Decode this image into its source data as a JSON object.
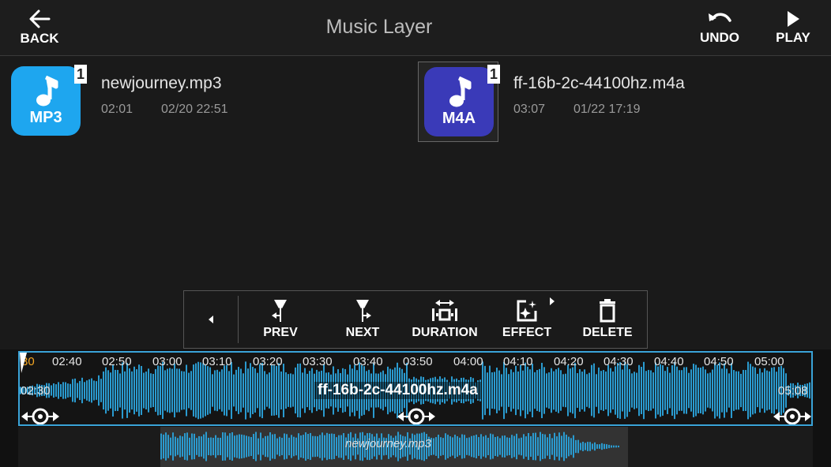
{
  "header": {
    "title": "Music Layer",
    "back_label": "BACK",
    "undo_label": "UNDO",
    "play_label": "PLAY"
  },
  "files": [
    {
      "ext": "MP3",
      "badge": "1",
      "name": "newjourney.mp3",
      "duration": "02:01",
      "date": "02/20 22:51",
      "color": "#1ea6ef"
    },
    {
      "ext": "M4A",
      "badge": "1",
      "name": "ff-16b-2c-44100hz.m4a",
      "duration": "03:07",
      "date": "01/22 17:19",
      "color": "#3a3ab8"
    }
  ],
  "toolbar": {
    "prev_label": "PREV",
    "next_label": "NEXT",
    "duration_label": "DURATION",
    "effect_label": "EFFECT",
    "delete_label": "DELETE"
  },
  "timeline": {
    "ticks": [
      "30",
      "02:40",
      "02:50",
      "03:00",
      "03:10",
      "03:20",
      "03:30",
      "03:40",
      "03:50",
      "04:00",
      "04:10",
      "04:20",
      "04:30",
      "04:40",
      "04:50",
      "05:00"
    ],
    "clip_name": "ff-16b-2c-44100hz.m4a",
    "clip_start": "02:30",
    "clip_end": "05:08",
    "clip2_name": "newjourney.mp3"
  },
  "colors": {
    "accent": "#3aa3d8",
    "playhead": "#f5a623",
    "waveform": "#2a9bd0"
  }
}
